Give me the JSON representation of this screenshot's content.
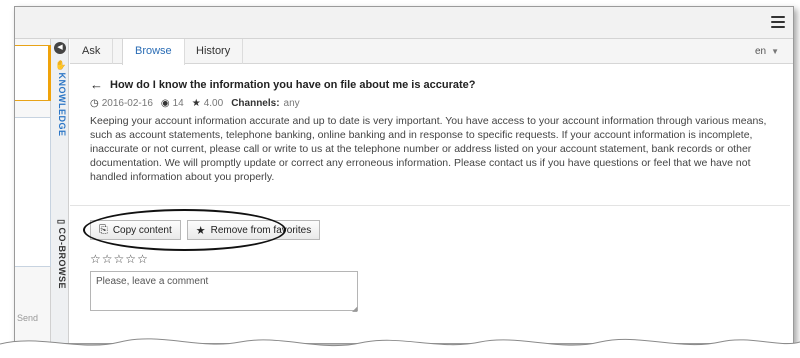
{
  "topbar": {
    "menu_icon": "hamburger-menu-icon"
  },
  "left_pane": {
    "send_label": "Send"
  },
  "side_tabs": {
    "collapse_icon": "collapse-left-icon",
    "knowledge_label": "KNOWLEDGE",
    "cobrowse_label": "CO-BROWSE"
  },
  "tabs": [
    {
      "label": "Ask"
    },
    {
      "label": "Browse",
      "active": true
    },
    {
      "label": "History"
    }
  ],
  "language": {
    "selected": "en"
  },
  "article": {
    "question": "How do I know the information you have on file about me is accurate?",
    "date": "2016-02-16",
    "views": "14",
    "rating": "4.00",
    "channels_label": "Channels:",
    "channels_value": "any",
    "body": "Keeping your account information accurate and up to date is very important. You have access to your account information through various means, such as account statements, telephone banking, online banking and in response to specific requests. If your account information is incomplete, inaccurate or not current, please call or write to us at the telephone number or address listed on your account statement, bank records or other documentation. We will promptly update or correct any erroneous information. Please contact us if you have questions or feel that we have not handled information about you properly."
  },
  "actions": {
    "copy_label": "Copy content",
    "favorite_label": "Remove from favorites"
  },
  "rating_stars": {
    "count": 5,
    "filled": 0
  },
  "comment": {
    "placeholder": "Please, leave a comment",
    "value": ""
  },
  "colors": {
    "accent": "#2b6db5",
    "orange": "#f0a30a"
  }
}
